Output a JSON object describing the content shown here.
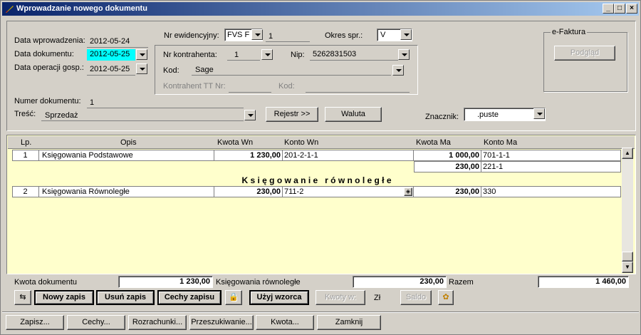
{
  "window": {
    "title": "Wprowadzanie nowego dokumentu"
  },
  "form": {
    "data_wprowadzenia_label": "Data wprowadzenia:",
    "data_wprowadzenia": "2012-05-24",
    "data_dokumentu_label": "Data dokumentu:",
    "data_dokumentu": "2012-05-25",
    "data_operacji_label": "Data operacji gosp.:",
    "data_operacji": "2012-05-25",
    "nr_ewidencyjny_label": "Nr ewidencyjny:",
    "nr_ewidencyjny_prefix": "FVS  F",
    "nr_ewidencyjny_value": "1",
    "okres_label": "Okres spr.:",
    "okres_value": "V",
    "nr_kontrahenta_label": "Nr kontrahenta:",
    "nr_kontrahenta_value": "1",
    "nip_label": "Nip:",
    "nip_value": "5262831503",
    "kod_label": "Kod:",
    "kod_value": "Sage",
    "kontrahent_tt_label": "Kontrahent TT Nr:",
    "kod2_label": "Kod:",
    "numer_dokumentu_label": "Numer dokumentu:",
    "numer_dokumentu_value": "1",
    "tresc_label": "Treść:",
    "tresc_value": "Sprzedaż",
    "rejestr_button": "Rejestr >>",
    "waluta_button": "Waluta",
    "znacznik_label": "Znacznik:",
    "znacznik_value": ".puste",
    "efaktura_label": "e-Faktura",
    "podglad_button": "Podgląd"
  },
  "grid": {
    "headers": {
      "lp": "Lp.",
      "opis": "Opis",
      "kwota_wn": "Kwota Wn",
      "konto_wn": "Konto Wn",
      "kwota_ma": "Kwota Ma",
      "konto_ma": "Konto Ma"
    },
    "rows": [
      {
        "lp": "1",
        "opis": "Księgowania Podstawowe",
        "kwota_wn": "1 230,00",
        "konto_wn": "201-2-1-1",
        "kwota_ma": "1 000,00",
        "konto_ma": "701-1-1"
      },
      {
        "lp": "",
        "opis": "",
        "kwota_wn": "",
        "konto_wn": "",
        "kwota_ma": "230,00",
        "konto_ma": "221-1"
      },
      {
        "lp": "2",
        "opis": "Księgowania Równoległe",
        "kwota_wn": "230,00",
        "konto_wn": "711-2",
        "kwota_ma": "230,00",
        "konto_ma": "330"
      }
    ],
    "section_heading": "K s i ę g o w a n i e   r ó w n o l e g ł e"
  },
  "totals": {
    "kwota_dokumentu_label": "Kwota dokumentu",
    "kwota_dokumentu": "1 230,00",
    "ksiegowania_rownolegle_label": "Księgowania równoległe",
    "ksiegowania_rownolegle": "230,00",
    "razem_label": "Razem",
    "razem": "1 460,00"
  },
  "toolbar": {
    "nowy_zapis": "Nowy zapis",
    "usun_zapis": "Usuń zapis",
    "cechy_zapisu": "Cechy zapisu",
    "uzyj_wzorca": "Użyj wzorca",
    "kwoty_w": "Kwoty w:",
    "currency": "Zł",
    "saldo": "Saldo"
  },
  "bottom": {
    "zapisz": "Zapisz...",
    "cechy": "Cechy...",
    "rozrachunki": "Rozrachunki...",
    "przeszukiwanie": "Przeszukiwanie...",
    "kwota": "Kwota...",
    "zamknij": "Zamknij"
  },
  "colors": {
    "title_start": "#0a246a",
    "title_end": "#a6caf0",
    "highlight_date": "#00ffff",
    "grid_bg": "#ffffcc"
  }
}
